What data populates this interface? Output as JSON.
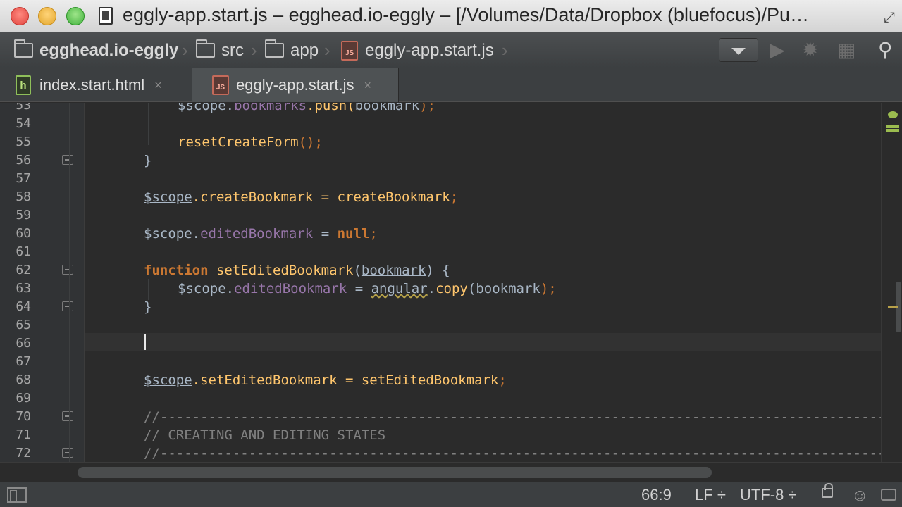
{
  "window": {
    "title": "eggly-app.start.js – egghead.io-eggly – [/Volumes/Data/Dropbox (bluefocus)/Pu…"
  },
  "breadcrumb": {
    "items": [
      {
        "label": "egghead.io-eggly",
        "icon": "folder-icon"
      },
      {
        "label": "src",
        "icon": "folder-icon"
      },
      {
        "label": "app",
        "icon": "folder-icon"
      },
      {
        "label": "eggly-app.start.js",
        "icon": "js-file-icon"
      }
    ],
    "separator": "›"
  },
  "toolbar": {
    "run_icon": "▶",
    "debug_icon": "✹",
    "coverage_icon": "▦",
    "search_icon": "⚲"
  },
  "tabs": [
    {
      "label": "index.start.html",
      "icon_text": "h",
      "close": "×",
      "active": false
    },
    {
      "label": "eggly-app.start.js",
      "icon_text": "JS",
      "close": "×",
      "active": true
    }
  ],
  "editor": {
    "line_numbers": [
      "53",
      "54",
      "55",
      "56",
      "57",
      "58",
      "59",
      "60",
      "61",
      "62",
      "63",
      "64",
      "65",
      "66",
      "67",
      "68",
      "69",
      "70",
      "71",
      "72"
    ],
    "code": {
      "l53": {
        "a": "$scope",
        "b": ".",
        "c": "bookmarks",
        "d": ".push(",
        "e": "bookmark",
        "f": ");"
      },
      "l55": {
        "a": "resetCreateForm",
        "b": "();"
      },
      "l56": {
        "a": "}"
      },
      "l58": {
        "a": "$scope",
        "b": ".createBookmark = ",
        "c": "createBookmark",
        "d": ";"
      },
      "l60": {
        "a": "$scope",
        "b": ".",
        "c": "editedBookmark",
        "d": " = ",
        "e": "null",
        "f": ";"
      },
      "l62": {
        "a": "function",
        "b": " ",
        "c": "setEditedBookmark",
        "d": "(",
        "e": "bookmark",
        "f": ") {"
      },
      "l63": {
        "a": "$scope",
        "b": ".",
        "c": "editedBookmark",
        "d": " = ",
        "e": "angular",
        "f": ".",
        "g": "copy",
        "h": "(",
        "i": "bookmark",
        "j": ");"
      },
      "l64": {
        "a": "}"
      },
      "l68": {
        "a": "$scope",
        "b": ".setEditedBookmark = ",
        "c": "setEditedBookmark",
        "d": ";"
      },
      "l70": {
        "a": "//-------------------------------------------------------------------------------------------------------------"
      },
      "l71": {
        "a": "// CREATING AND EDITING STATES"
      },
      "l72": {
        "a": "//-------------------------------------------------------------------------------------------------------------"
      }
    }
  },
  "status": {
    "position": "66:9",
    "line_separator": "LF",
    "encoding": "UTF-8",
    "dropdown_glyph": "÷"
  },
  "colors": {
    "keyword": "#cc7832",
    "function": "#ffc66d",
    "property": "#9876aa",
    "comment": "#808080",
    "text": "#a9b7c6",
    "background": "#2b2b2b"
  }
}
